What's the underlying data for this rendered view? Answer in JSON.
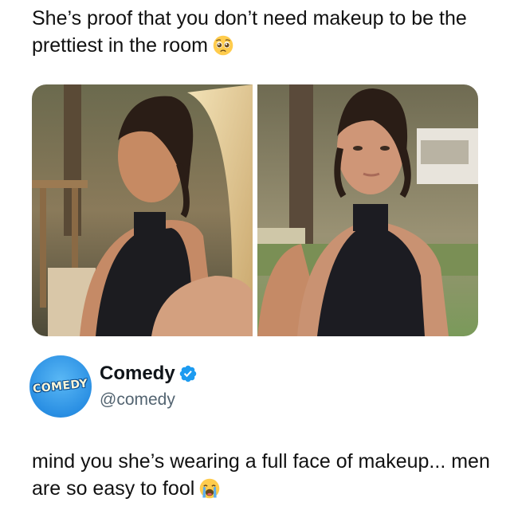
{
  "caption": {
    "text": "She’s proof that you don’t need makeup to be the prettiest in the room",
    "emoji": "pleading-face-emoji"
  },
  "media": {
    "photos": [
      {
        "name": "photo-left",
        "description_icon": "image"
      },
      {
        "name": "photo-right",
        "description_icon": "image"
      }
    ]
  },
  "account": {
    "avatar_text": "COMEDY",
    "display_name": "Comedy",
    "handle": "@comedy",
    "verified": true,
    "verified_color": "#1d9bf0"
  },
  "tweet": {
    "text": "mind you she’s wearing a full face of makeup... men are so easy to fool",
    "emoji": "loudly-crying-face-emoji"
  }
}
